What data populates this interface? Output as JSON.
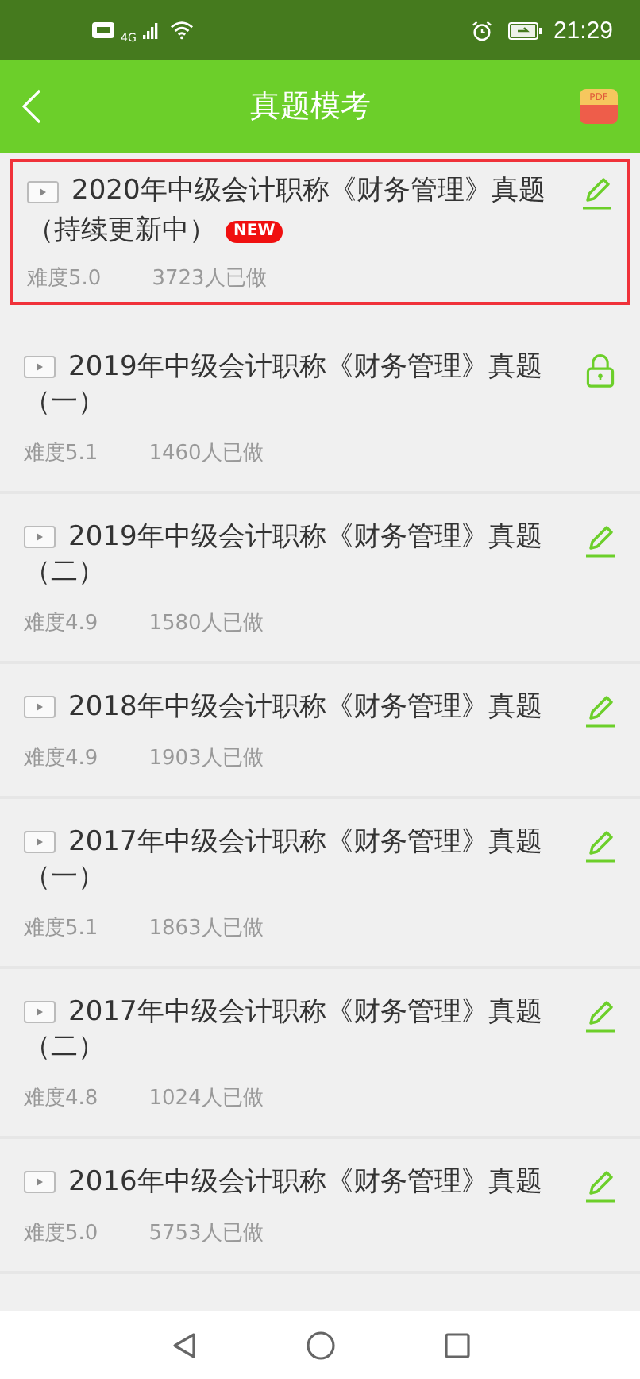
{
  "status_bar": {
    "network": "4G",
    "time": "21:29"
  },
  "header": {
    "title": "真题模考",
    "pdf_label": "PDF"
  },
  "papers": [
    {
      "title": "2020年中级会计职称《财务管理》真题",
      "subtitle": "（持续更新中）",
      "badge": "NEW",
      "difficulty": "难度5.0",
      "done": "3723人已做",
      "kind": "edit",
      "selected": true
    },
    {
      "title": "2019年中级会计职称《财务管理》真题",
      "subtitle": "（一）",
      "difficulty": "难度5.1",
      "done": "1460人已做",
      "kind": "locked",
      "selected": false
    },
    {
      "title": "2019年中级会计职称《财务管理》真题",
      "subtitle": "（二）",
      "difficulty": "难度4.9",
      "done": "1580人已做",
      "kind": "edit",
      "selected": false
    },
    {
      "title": "2018年中级会计职称《财务管理》真题",
      "difficulty": "难度4.9",
      "done": "1903人已做",
      "kind": "edit",
      "selected": false
    },
    {
      "title": "2017年中级会计职称《财务管理》真题",
      "subtitle": "（一）",
      "difficulty": "难度5.1",
      "done": "1863人已做",
      "kind": "edit",
      "selected": false
    },
    {
      "title": "2017年中级会计职称《财务管理》真题",
      "subtitle": "（二）",
      "difficulty": "难度4.8",
      "done": "1024人已做",
      "kind": "edit",
      "selected": false
    },
    {
      "title": "2016年中级会计职称《财务管理》真题",
      "difficulty": "难度5.0",
      "done": "5753人已做",
      "kind": "edit",
      "selected": false
    }
  ]
}
